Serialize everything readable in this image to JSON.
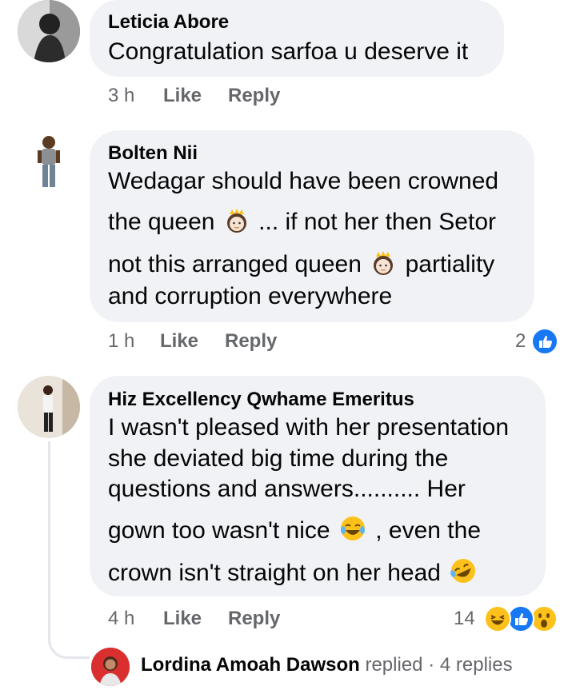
{
  "comments": [
    {
      "author": "Leticia Abore",
      "lines": [
        "Congratulation sarfoa u deserve it"
      ],
      "time": "3 h",
      "like_label": "Like",
      "reply_label": "Reply"
    },
    {
      "author": "Bolten Nii",
      "lines": [
        "Wedagar should have been crowned",
        "the queen",
        "... if not her then Setor",
        "not this arranged queen",
        "partiality",
        "and corruption everywhere"
      ],
      "time": "1 h",
      "like_label": "Like",
      "reply_label": "Reply",
      "reaction_count": "2",
      "reactions": [
        "like-icon"
      ]
    },
    {
      "author": "Hiz Excellency Qwhame Emeritus",
      "lines": [
        "I wasn't pleased with her presentation",
        "she deviated big time during the",
        "questions and answers.......... Her",
        "gown too wasn't nice",
        ", even the",
        "crown isn't straight on her head"
      ],
      "time": "4 h",
      "like_label": "Like",
      "reply_label": "Reply",
      "reaction_count": "14",
      "reactions": [
        "haha-icon",
        "like-icon",
        "wow-icon"
      ]
    }
  ],
  "reply_preview": {
    "author": "Lordina Amoah Dawson",
    "action": "replied",
    "separator": "·",
    "count": "4 replies"
  },
  "colors": {
    "bubble": "#f0f2f5",
    "meta_text": "#65676b",
    "like_blue": "#1877f2",
    "emoji_yellow": "#fcc21b"
  }
}
